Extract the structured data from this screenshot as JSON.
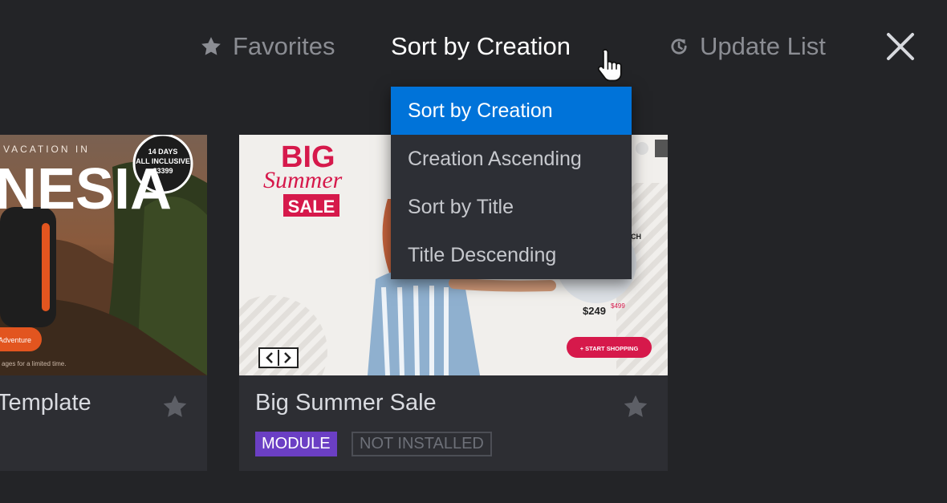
{
  "toolbar": {
    "favorites": {
      "label": "Favorites",
      "icon": "star-icon"
    },
    "sort": {
      "label": "Sort by Creation"
    },
    "update": {
      "label": "Update List",
      "icon": "refresh-icon"
    },
    "close": {
      "icon": "close-icon"
    }
  },
  "dropdown": {
    "items": [
      {
        "label": "Sort by Creation",
        "active": true
      },
      {
        "label": "Creation Ascending",
        "active": false
      },
      {
        "label": "Sort by Title",
        "active": false
      },
      {
        "label": "Title Descending",
        "active": false
      }
    ]
  },
  "cards": [
    {
      "title": "Template",
      "thumbnail": {
        "headline_partial": "NESIA",
        "kicker": "VACATION IN",
        "badge": [
          "14 DAYS",
          "ALL INCLUSIVE",
          "$3399"
        ],
        "button": "Adventure",
        "footnote": "ages for a limited time."
      }
    },
    {
      "title": "Big Summer Sale",
      "badges": {
        "type": "MODULE",
        "status": "NOT INSTALLED"
      },
      "thumbnail": {
        "line1": "BIG",
        "line2": "Summer",
        "line3": "SALE",
        "price": "$249",
        "old_price": "$499",
        "button": "+ START SHOPPING",
        "side_text": "CH"
      }
    }
  ],
  "colors": {
    "background": "#232427",
    "accent": "#0073d9",
    "module_badge": "#6b3fc4",
    "sale_red": "#d6194b"
  }
}
